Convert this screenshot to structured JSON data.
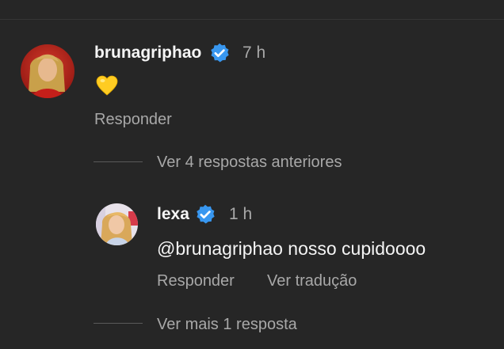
{
  "comment": {
    "username": "brunagriphao",
    "time": "7 h",
    "emoji_icon": "yellow-heart-icon",
    "emoji_color": "#ffcc22",
    "reply_label": "Responder"
  },
  "thread": {
    "view_previous_label": "Ver 4 respostas anteriores",
    "view_more_label": "Ver mais 1 resposta"
  },
  "reply": {
    "username": "lexa",
    "time": "1 h",
    "text": "@brunagriphao nosso cupidoooo",
    "reply_label": "Responder",
    "translate_label": "Ver tradução"
  },
  "colors": {
    "background": "#262626",
    "verified": "#3897f0",
    "secondary_text": "#a8a8a8"
  }
}
